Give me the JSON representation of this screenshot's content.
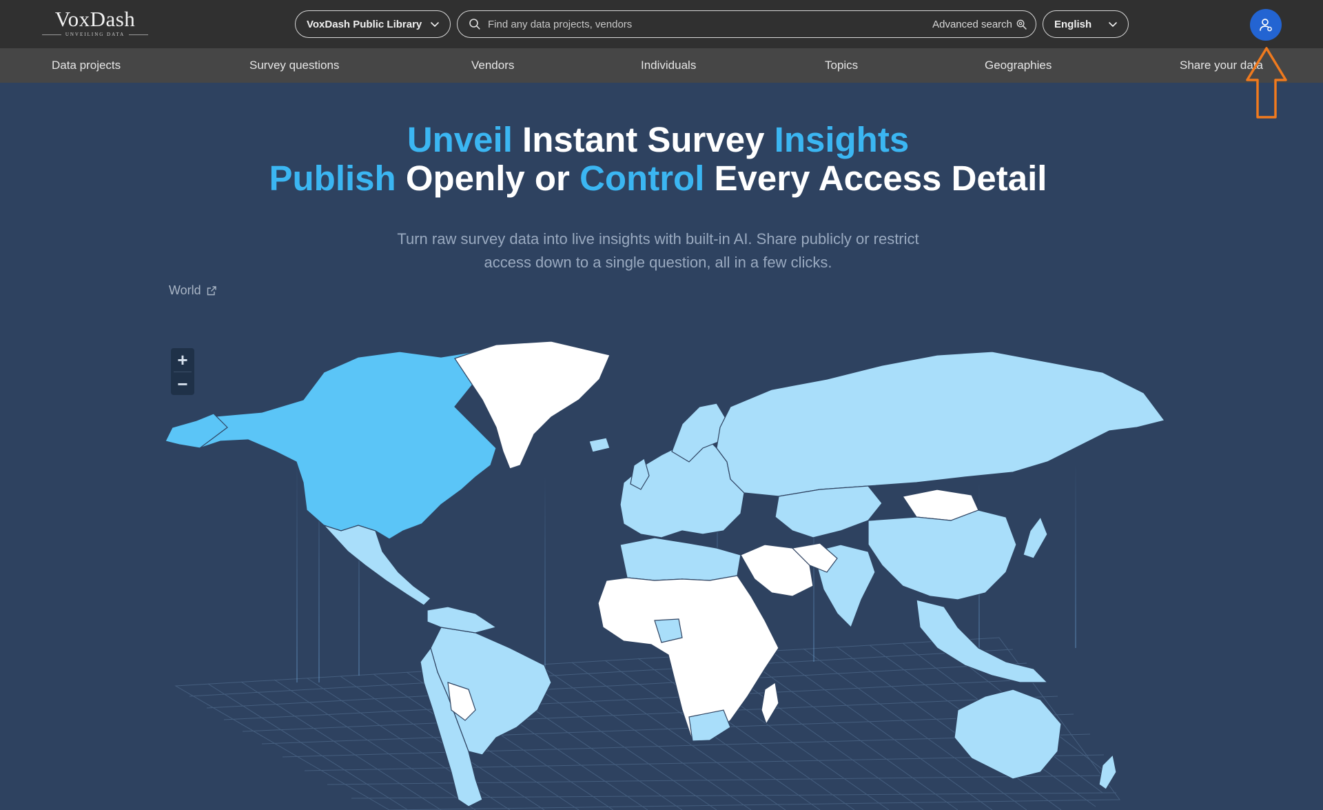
{
  "app": {
    "logo_name": "VoxDash",
    "logo_tagline": "UNVEILING DATA"
  },
  "header": {
    "library_select": "VoxDash Public Library",
    "search_placeholder": "Find any data projects, vendors",
    "advanced_search": "Advanced search",
    "language": "English"
  },
  "nav": {
    "items": [
      "Data projects",
      "Survey questions",
      "Vendors",
      "Individuals",
      "Topics",
      "Geographies",
      "Share your data"
    ]
  },
  "hero": {
    "line1": [
      "Unveil",
      " Instant Survey ",
      "Insights"
    ],
    "line2": [
      "Publish",
      " Openly or ",
      "Control",
      " Every Access Detail"
    ],
    "subtitle": "Turn raw survey data into live insights with built-in AI. Share publicly or restrict access down to a single question, all in a few clicks.",
    "world_link": "World"
  },
  "map": {
    "zoom_in": "+",
    "zoom_out": "−",
    "colors": {
      "background": "#2e4260",
      "highlight_strong": "#5bc5f7",
      "highlight_light": "#a9defa",
      "no_data": "#ffffff",
      "grid": "#4d6889"
    }
  },
  "colors": {
    "accent": "#3bb6f2",
    "topbar": "#303030",
    "navbar": "#464646",
    "user_button": "#2364d2",
    "annotation_arrow": "#f07a1e"
  }
}
